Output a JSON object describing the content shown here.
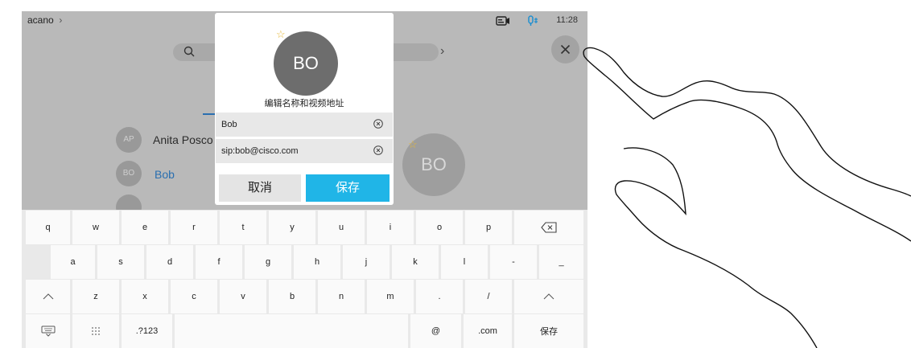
{
  "status": {
    "breadcrumb": "acano",
    "breadcrumb_chevron": "›",
    "time": "11:28"
  },
  "background": {
    "search_chevron": "›",
    "contacts": [
      {
        "initials": "AP",
        "name": "Anita Posco"
      },
      {
        "initials": "BO",
        "name": "Bob"
      }
    ],
    "large_avatar_initials": "BO"
  },
  "modal": {
    "avatar_initials": "BO",
    "title": "编辑名称和视频地址",
    "name_value": "Bob",
    "address_value": "sip:bob@cisco.com",
    "cancel_label": "取消",
    "save_label": "保存"
  },
  "keyboard": {
    "row1": [
      "q",
      "w",
      "e",
      "r",
      "t",
      "y",
      "u",
      "i",
      "o",
      "p"
    ],
    "row2": [
      "a",
      "s",
      "d",
      "f",
      "g",
      "h",
      "j",
      "k",
      "l",
      "-",
      "_"
    ],
    "row3": [
      "z",
      "x",
      "c",
      "v",
      "b",
      "n",
      "m",
      ".",
      "/"
    ],
    "row4": {
      "numbers": ".?123",
      "at": "@",
      "com": ".com",
      "save": "保存"
    }
  },
  "colors": {
    "accent": "#20b5e7",
    "favorite_star": "#e6b838",
    "link": "#2a6fb0"
  },
  "icons": [
    "camera-icon",
    "microphone-icon",
    "close-icon",
    "search-icon",
    "clear-icon",
    "backspace-icon",
    "shift-icon",
    "keyboard-hide-icon",
    "dots-grid-icon",
    "star-icon"
  ]
}
